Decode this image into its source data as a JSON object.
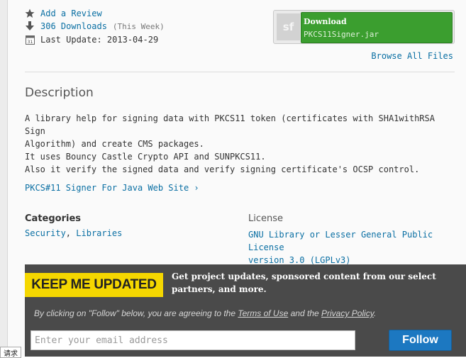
{
  "stats": {
    "review_label": "Add a Review",
    "downloads_label": "306 Downloads",
    "downloads_period": "(This Week)",
    "last_update_label": "Last Update: 2013-04-29",
    "calendar_day": "31"
  },
  "download": {
    "sf_logo_text": "sf",
    "title": "Download",
    "filename": "PKCS11Signer.jar"
  },
  "browse_files": "Browse All Files",
  "description": {
    "heading": "Description",
    "lines": [
      "A library help for signing data with PKCS11 token (certificates with SHA1withRSA Sign",
      "Algorithm) and create CMS packages.",
      "It uses Bouncy Castle Crypto API and SUNPKCS11.",
      "Also it verify the signed data and verify signing certificate's OCSP control."
    ],
    "site_link": "PKCS#11 Signer For Java Web Site",
    "site_chevron": "›"
  },
  "categories": {
    "heading": "Categories",
    "items": [
      "Security",
      "Libraries"
    ],
    "separator": ","
  },
  "license": {
    "heading": "License",
    "line1": "GNU Library or Lesser General Public License",
    "line2": "version 3.0 (LGPLv3)"
  },
  "newsletter": {
    "badge": "KEEP ME UPDATED",
    "text": "Get project updates, sponsored content from our select partners, and more.",
    "legal_prefix": "By clicking on \"Follow\" below, you are agreeing to the",
    "terms": "Terms of Use",
    "legal_and": "and the",
    "privacy": "Privacy Policy",
    "legal_suffix": ".",
    "email_placeholder": "Enter your email address",
    "follow_label": "Follow"
  },
  "status_tip": "请求",
  "colors": {
    "link": "#0a6fa3",
    "download_green": "#3b9e2f",
    "follow_blue": "#1c78c1",
    "badge_yellow": "#f5d700",
    "newsletter_bg": "#4a4a4a"
  }
}
